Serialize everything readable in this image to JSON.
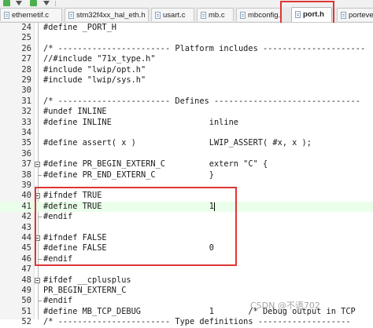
{
  "tabs": [
    {
      "label": "ethernetif.c"
    },
    {
      "label": "stm32f4xx_hal_eth.h"
    },
    {
      "label": "usart.c"
    },
    {
      "label": "mb.c"
    },
    {
      "label": "mbconfig.h"
    },
    {
      "label": "port.h",
      "active": true
    },
    {
      "label": "porteve"
    }
  ],
  "editor": {
    "lines": [
      {
        "n": "24",
        "code": "#define _PORT_H"
      },
      {
        "n": "25",
        "code": ""
      },
      {
        "n": "26",
        "code": "/* ----------------------- Platform includes ---------------------"
      },
      {
        "n": "27",
        "code": "//#include \"71x_type.h\""
      },
      {
        "n": "28",
        "code": "#include \"lwip/opt.h\""
      },
      {
        "n": "29",
        "code": "#include \"lwip/sys.h\""
      },
      {
        "n": "30",
        "code": ""
      },
      {
        "n": "31",
        "code": "/* ----------------------- Defines ------------------------------"
      },
      {
        "n": "32",
        "code": "#undef INLINE"
      },
      {
        "n": "33",
        "code": "#define INLINE                    inline"
      },
      {
        "n": "34",
        "code": ""
      },
      {
        "n": "35",
        "code": "#define assert( x )               LWIP_ASSERT( #x, x );"
      },
      {
        "n": "36",
        "code": ""
      },
      {
        "n": "37",
        "code": "#define PR_BEGIN_EXTERN_C         extern \"C\" {"
      },
      {
        "n": "38",
        "code": "#define PR_END_EXTERN_C           }"
      },
      {
        "n": "39",
        "code": ""
      },
      {
        "n": "40",
        "code": "#ifndef TRUE"
      },
      {
        "n": "41",
        "code": "#define TRUE                      1"
      },
      {
        "n": "42",
        "code": "#endif"
      },
      {
        "n": "43",
        "code": ""
      },
      {
        "n": "44",
        "code": "#ifndef FALSE"
      },
      {
        "n": "45",
        "code": "#define FALSE                     0"
      },
      {
        "n": "46",
        "code": "#endif"
      },
      {
        "n": "47",
        "code": ""
      },
      {
        "n": "48",
        "code": "#ifdef __cplusplus"
      },
      {
        "n": "49",
        "code": "PR_BEGIN_EXTERN_C"
      },
      {
        "n": "50",
        "code": "#endif"
      },
      {
        "n": "51",
        "code": "#define MB_TCP_DEBUG              1       /* Debug output in TCP"
      },
      {
        "n": "52",
        "code": "/* ----------------------- Type definitions -------------------"
      }
    ]
  },
  "watermark": "CSDN @不语702",
  "colors": {
    "highlight_border": "#e03535",
    "keyword": "#000080",
    "comment": "#008000",
    "string": "#800000",
    "number": "#0000ff"
  }
}
